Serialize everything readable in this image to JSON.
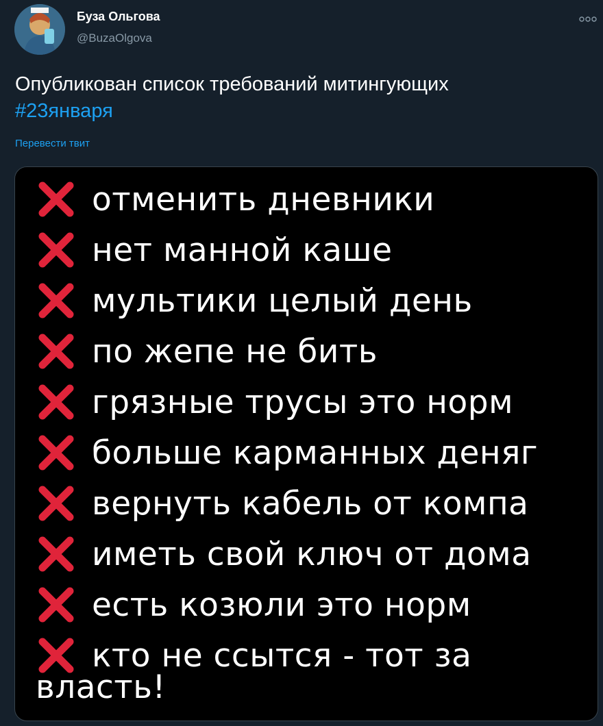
{
  "author": {
    "name": "Буза Ольгова",
    "handle": "@BuzaOlgova",
    "avatar_icon": "portrait-avatar-icon"
  },
  "more_icon": "more-dots-icon",
  "tweet": {
    "text": "Опубликован список требований митингующих",
    "hashtag": "#23января",
    "translate_label": "Перевести твит"
  },
  "image": {
    "demands": [
      "отменить дневники",
      "нет манной каше",
      "мультики целый день",
      "по жепе не бить",
      "грязные трусы это норм",
      "больше карманных деняг",
      "вернуть кабель от компа",
      "иметь свой ключ от дома",
      "есть козюли это норм",
      "кто не ссытся - тот за"
    ],
    "tail": "власть!",
    "cross_icon": "red-cross-icon",
    "cross_color": "#e0243a"
  },
  "colors": {
    "background": "#15202b",
    "link": "#1da1f2",
    "secondary_text": "#8899a6"
  }
}
